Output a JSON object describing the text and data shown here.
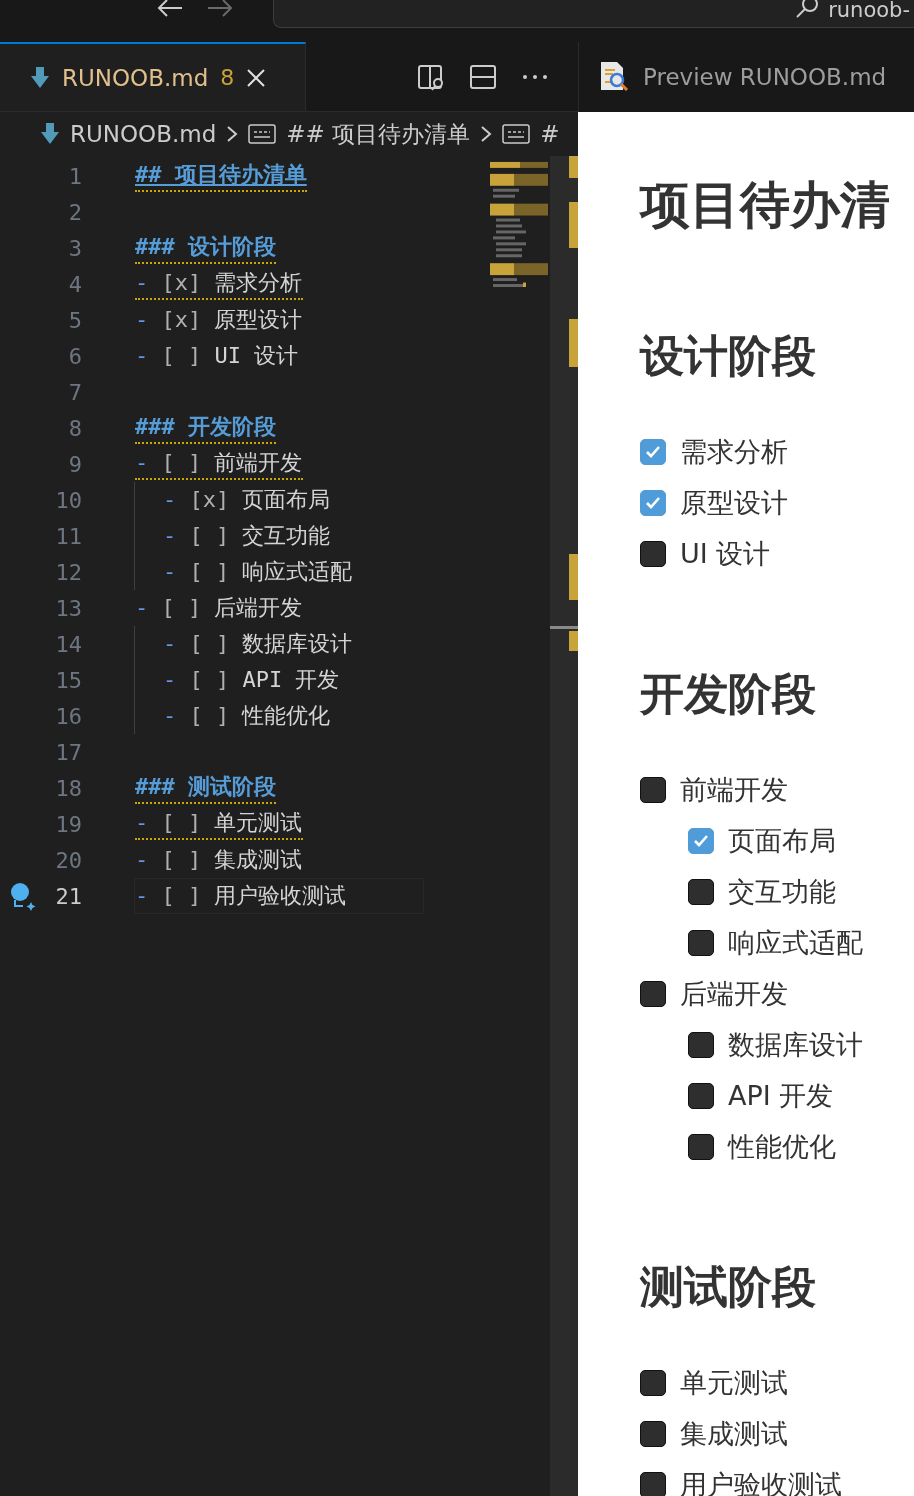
{
  "titlebar": {
    "search_text": "runoob-"
  },
  "editor_tab": {
    "label": "RUNOOB.md",
    "badge": "8",
    "selected": true
  },
  "preview_tab": {
    "label": "Preview RUNOOB.md",
    "selected": false
  },
  "breadcrumb": [
    "RUNOOB.md",
    "## 项目待办清单",
    "#"
  ],
  "editor_lines": [
    {
      "number": "1",
      "kind": "heading",
      "marker": "##",
      "text": "项目待办清单",
      "warning": true,
      "link": true,
      "current": false
    },
    {
      "number": "2",
      "kind": "blank",
      "current": false
    },
    {
      "number": "3",
      "kind": "heading",
      "marker": "###",
      "text": "设计阶段",
      "warning": true,
      "link": false,
      "current": false
    },
    {
      "number": "4",
      "kind": "task",
      "marker": "-",
      "box": "[x]",
      "text": "需求分析",
      "warning": true,
      "current": false
    },
    {
      "number": "5",
      "kind": "task",
      "marker": "-",
      "box": "[x]",
      "text": "原型设计",
      "warning": false,
      "current": false
    },
    {
      "number": "6",
      "kind": "task",
      "marker": "-",
      "box": "[ ]",
      "text": "UI 设计",
      "warning": false,
      "current": false
    },
    {
      "number": "7",
      "kind": "blank",
      "current": false
    },
    {
      "number": "8",
      "kind": "heading",
      "marker": "###",
      "text": "开发阶段",
      "warning": true,
      "link": false,
      "current": false
    },
    {
      "number": "9",
      "kind": "task",
      "marker": "-",
      "box": "[ ]",
      "text": "前端开发",
      "warning": true,
      "current": false,
      "children": [
        {
          "number": "10",
          "kind": "task",
          "marker": "-",
          "box": "[x]",
          "text": "页面布局",
          "warning": false,
          "current": false
        },
        {
          "number": "11",
          "kind": "task",
          "marker": "-",
          "box": "[ ]",
          "text": "交互功能",
          "warning": false,
          "current": false
        },
        {
          "number": "12",
          "kind": "task",
          "marker": "-",
          "box": "[ ]",
          "text": "响应式适配",
          "warning": false,
          "current": false
        }
      ]
    },
    {
      "number": "13",
      "kind": "task",
      "marker": "-",
      "box": "[ ]",
      "text": "后端开发",
      "warning": false,
      "current": false,
      "children": [
        {
          "number": "14",
          "kind": "task",
          "marker": "-",
          "box": "[ ]",
          "text": "数据库设计",
          "warning": false,
          "current": false
        },
        {
          "number": "15",
          "kind": "task",
          "marker": "-",
          "box": "[ ]",
          "text": "API 开发",
          "warning": false,
          "current": false
        },
        {
          "number": "16",
          "kind": "task",
          "marker": "-",
          "box": "[ ]",
          "text": "性能优化",
          "warning": false,
          "current": false
        }
      ]
    },
    {
      "number": "17",
      "kind": "blank",
      "current": false
    },
    {
      "number": "18",
      "kind": "heading",
      "marker": "###",
      "text": "测试阶段",
      "warning": true,
      "link": false,
      "current": false
    },
    {
      "number": "19",
      "kind": "task",
      "marker": "-",
      "box": "[ ]",
      "text": "单元测试",
      "warning": true,
      "current": false
    },
    {
      "number": "20",
      "kind": "task",
      "marker": "-",
      "box": "[ ]",
      "text": "集成测试",
      "warning": false,
      "current": false
    },
    {
      "number": "21",
      "kind": "task",
      "marker": "-",
      "box": "[ ]",
      "text": "用户验收测试",
      "warning": false,
      "current": true
    }
  ],
  "preview": {
    "title": "项目待办清",
    "sections": [
      {
        "heading": "设计阶段",
        "items": [
          {
            "text": "需求分析",
            "checked": true
          },
          {
            "text": "原型设计",
            "checked": true
          },
          {
            "text": "UI 设计",
            "checked": false
          }
        ]
      },
      {
        "heading": "开发阶段",
        "items": [
          {
            "text": "前端开发",
            "checked": false,
            "children": [
              {
                "text": "页面布局",
                "checked": true
              },
              {
                "text": "交互功能",
                "checked": false
              },
              {
                "text": "响应式适配",
                "checked": false
              }
            ]
          },
          {
            "text": "后端开发",
            "checked": false,
            "children": [
              {
                "text": "数据库设计",
                "checked": false
              },
              {
                "text": "API 开发",
                "checked": false
              },
              {
                "text": "性能优化",
                "checked": false
              }
            ]
          }
        ]
      },
      {
        "heading": "测试阶段",
        "items": [
          {
            "text": "单元测试",
            "checked": false
          },
          {
            "text": "集成测试",
            "checked": false
          },
          {
            "text": "用户验收测试",
            "checked": false
          }
        ]
      }
    ]
  }
}
